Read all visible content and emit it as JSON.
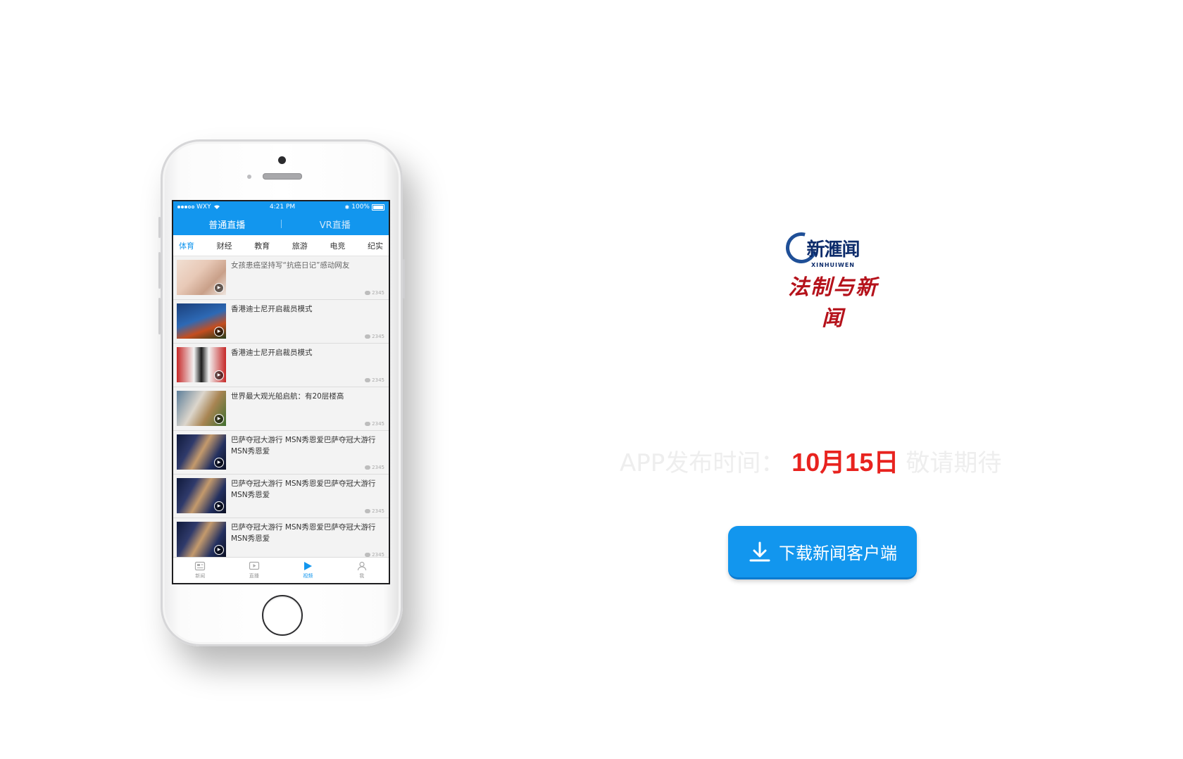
{
  "phone": {
    "status": {
      "carrier": "WXY",
      "time": "4:21 PM",
      "battery": "100%"
    },
    "top_tabs": [
      {
        "label": "普通直播"
      },
      {
        "label": "VR直播"
      }
    ],
    "categories": [
      {
        "label": "体育"
      },
      {
        "label": "财经"
      },
      {
        "label": "教育"
      },
      {
        "label": "旅游"
      },
      {
        "label": "电竞"
      },
      {
        "label": "纪实"
      }
    ],
    "items": [
      {
        "title": "女孩患癌坚持写“抗癌日记”感动网友",
        "count": "2345"
      },
      {
        "title": "香港迪士尼开启裁员模式",
        "count": "2345"
      },
      {
        "title": "香港迪士尼开启裁员模式",
        "count": "2345"
      },
      {
        "title": "世界最大观光船启航：有20层楼高",
        "count": "2345"
      },
      {
        "title": "巴萨夺冠大游行 MSN秀恩爱巴萨夺冠大游行 MSN秀恩爱",
        "count": "2345"
      },
      {
        "title": "巴萨夺冠大游行 MSN秀恩爱巴萨夺冠大游行 MSN秀恩爱",
        "count": "2345"
      },
      {
        "title": "巴萨夺冠大游行 MSN秀恩爱巴萨夺冠大游行 MSN秀恩爱",
        "count": "2345"
      }
    ],
    "tabbar": [
      {
        "label": "新闻",
        "icon": "news-icon"
      },
      {
        "label": "直播",
        "icon": "live-icon"
      },
      {
        "label": "视频",
        "icon": "video-icon"
      },
      {
        "label": "我",
        "icon": "user-icon"
      }
    ]
  },
  "logo": {
    "cn": "新滙闻",
    "en": "XINHUIWEN",
    "red": "法制与新闻"
  },
  "release": {
    "prefix": "APP发布时间：",
    "date": "10月15日",
    "suffix": "敬请期待"
  },
  "download": {
    "label": "下载新闻客户端"
  },
  "colors": {
    "accent": "#1296ee",
    "date_red": "#e8231f",
    "logo_red": "#b5121b",
    "logo_navy": "#0d2c6b"
  }
}
